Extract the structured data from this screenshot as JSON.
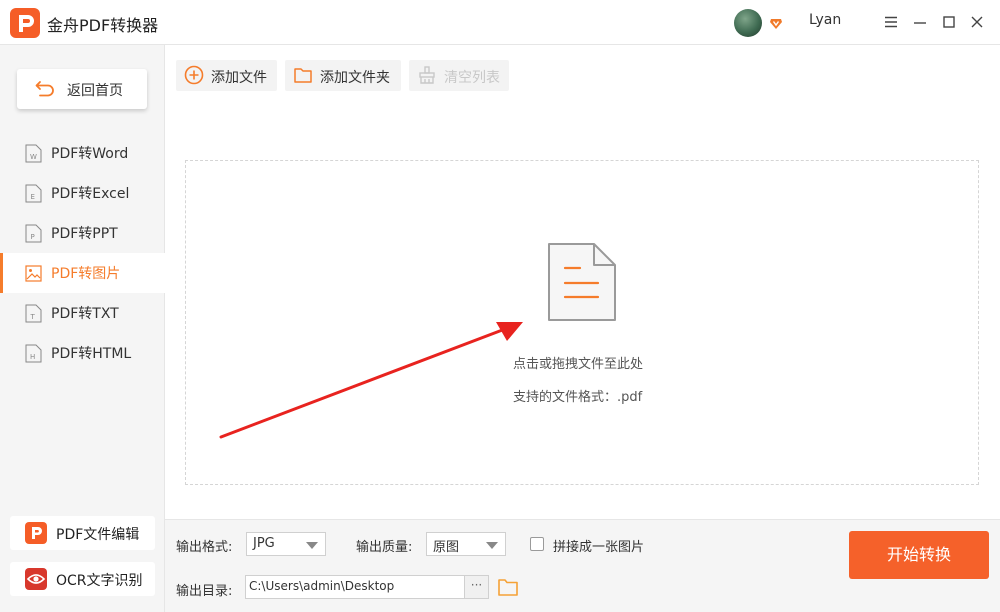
{
  "app": {
    "title": "金舟PDF转换器",
    "user_name": "Lyan"
  },
  "sidebar": {
    "back_label": "返回首页",
    "items": [
      {
        "label": "PDF转Word",
        "icon": "word-file-icon",
        "letter": "W"
      },
      {
        "label": "PDF转Excel",
        "icon": "excel-file-icon",
        "letter": "E"
      },
      {
        "label": "PDF转PPT",
        "icon": "ppt-file-icon",
        "letter": "P"
      },
      {
        "label": "PDF转图片",
        "icon": "image-file-icon",
        "letter": ""
      },
      {
        "label": "PDF转TXT",
        "icon": "txt-file-icon",
        "letter": "T"
      },
      {
        "label": "PDF转HTML",
        "icon": "html-file-icon",
        "letter": "H"
      }
    ],
    "active_index": 3,
    "tools": [
      {
        "label": "PDF文件编辑",
        "icon": "pdf-edit-icon"
      },
      {
        "label": "OCR文字识别",
        "icon": "ocr-eye-icon"
      }
    ]
  },
  "toolbar": {
    "add_file": "添加文件",
    "add_folder": "添加文件夹",
    "clear_list": "清空列表"
  },
  "dropzone": {
    "hint": "点击或拖拽文件至此处",
    "formats": "支持的文件格式：.pdf"
  },
  "output": {
    "format_label": "输出格式:",
    "format_value": "JPG",
    "quality_label": "输出质量:",
    "quality_value": "原图",
    "merge_label": "拼接成一张图片",
    "merge_checked": false,
    "dir_label": "输出目录:",
    "dir_value": "C:\\Users\\admin\\Desktop",
    "more_label": "···"
  },
  "start_label": "开始转换",
  "colors": {
    "accent": "#f57c2b",
    "start": "#f5612a",
    "arrow": "#e8231f"
  }
}
